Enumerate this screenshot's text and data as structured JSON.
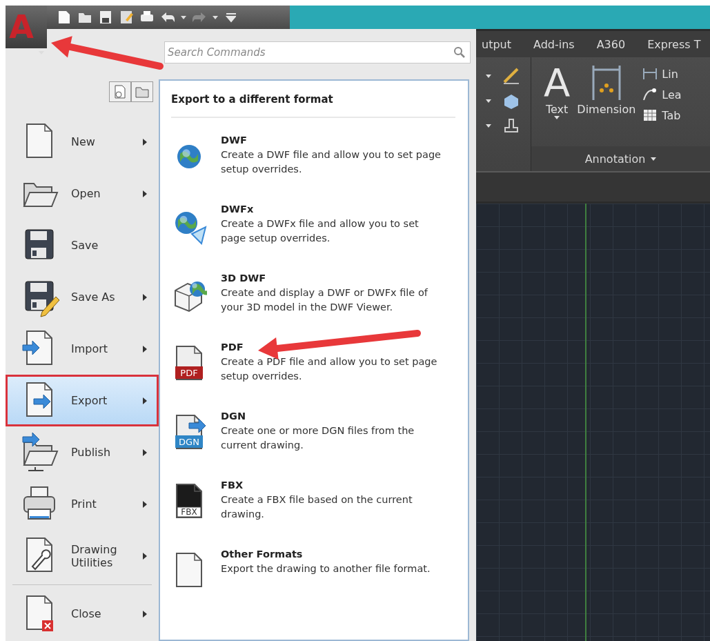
{
  "app_button": {
    "label": "A"
  },
  "search": {
    "placeholder": "Search Commands"
  },
  "menu_items": [
    {
      "label": "New",
      "has_submenu": true,
      "selected": false
    },
    {
      "label": "Open",
      "has_submenu": true,
      "selected": false
    },
    {
      "label": "Save",
      "has_submenu": false,
      "selected": false
    },
    {
      "label": "Save As",
      "has_submenu": true,
      "selected": false
    },
    {
      "label": "Import",
      "has_submenu": true,
      "selected": false
    },
    {
      "label": "Export",
      "has_submenu": true,
      "selected": true
    },
    {
      "label": "Publish",
      "has_submenu": true,
      "selected": false
    },
    {
      "label": "Print",
      "has_submenu": true,
      "selected": false
    },
    {
      "label": "Drawing Utilities",
      "has_submenu": true,
      "selected": false
    },
    {
      "label": "Close",
      "has_submenu": true,
      "selected": false
    }
  ],
  "flyout": {
    "title": "Export to a different format",
    "items": [
      {
        "title": "DWF",
        "description": "Create a DWF file and allow you to set page setup overrides."
      },
      {
        "title": "DWFx",
        "description": "Create a DWFx file and allow you to set page setup overrides."
      },
      {
        "title": "3D DWF",
        "description": "Create and display a DWF or DWFx file of your 3D model in the DWF Viewer."
      },
      {
        "title": "PDF",
        "description": "Create a PDF file and allow you to set page setup overrides.",
        "icon_label": "PDF"
      },
      {
        "title": "DGN",
        "description": "Create one or more DGN files from the current drawing.",
        "icon_label": "DGN"
      },
      {
        "title": "FBX",
        "description": "Create a FBX file based on the current drawing.",
        "icon_label": "FBX"
      },
      {
        "title": "Other Formats",
        "description": "Export the drawing to another file format."
      }
    ]
  },
  "ribbon": {
    "tabs": [
      "utput",
      "Add-ins",
      "A360",
      "Express T"
    ],
    "text_tool": {
      "glyph": "A",
      "label": "Text"
    },
    "dimension_tool": {
      "label": "Dimension"
    },
    "small_tools": [
      "Lin",
      "Lea",
      "Tab"
    ],
    "panel_label": "Annotation"
  }
}
